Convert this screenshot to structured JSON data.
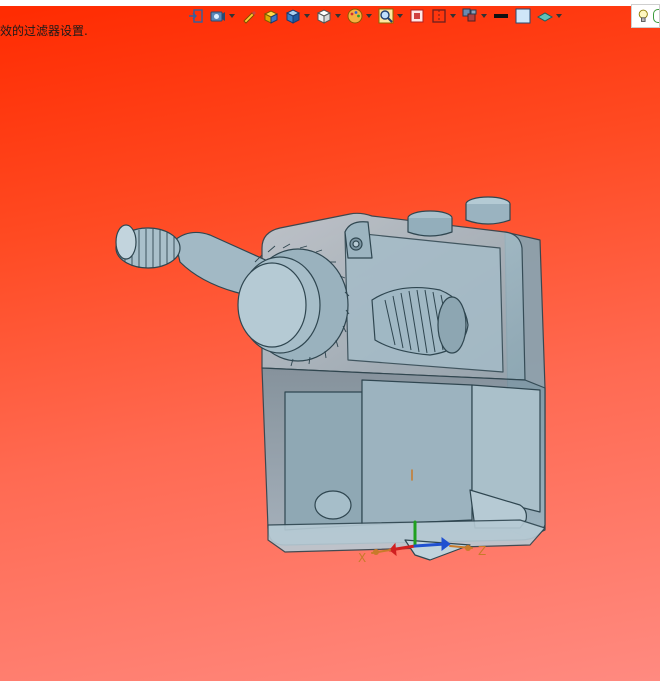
{
  "status": {
    "text": "效的过滤器设置."
  },
  "toolbar": {
    "items": [
      {
        "icon": "view-orient-icon",
        "has_dropdown": false
      },
      {
        "icon": "camera-view-icon",
        "has_dropdown": true
      },
      {
        "icon": "pencil-sketch-icon",
        "has_dropdown": false
      },
      {
        "icon": "part-box-yellow-icon",
        "has_dropdown": false
      },
      {
        "icon": "shaded-cube-icon",
        "has_dropdown": true
      },
      {
        "icon": "wireframe-cube-icon",
        "has_dropdown": true
      },
      {
        "icon": "appearance-palette-icon",
        "has_dropdown": true
      },
      {
        "icon": "zoom-fit-icon",
        "has_dropdown": true
      },
      {
        "icon": "section-view-icon",
        "has_dropdown": false
      },
      {
        "icon": "hidden-lines-icon",
        "has_dropdown": true
      },
      {
        "icon": "display-layers-icon",
        "has_dropdown": true
      },
      {
        "icon": "edge-color-icon",
        "has_dropdown": false
      },
      {
        "icon": "background-icon",
        "has_dropdown": false
      },
      {
        "icon": "scene-render-icon",
        "has_dropdown": true
      },
      {
        "icon": "lightbulb-icon",
        "has_dropdown": false
      }
    ]
  },
  "triad": {
    "x_label": "X",
    "z_label": "Z"
  },
  "colors": {
    "bg_top": "#ff2a00",
    "bg_bottom": "#ff8a80",
    "model_fill": "#9fb8c4",
    "model_edge": "#2f4650",
    "x_axis": "#d02020",
    "y_axis": "#20a020",
    "z_axis": "#2050d0"
  }
}
